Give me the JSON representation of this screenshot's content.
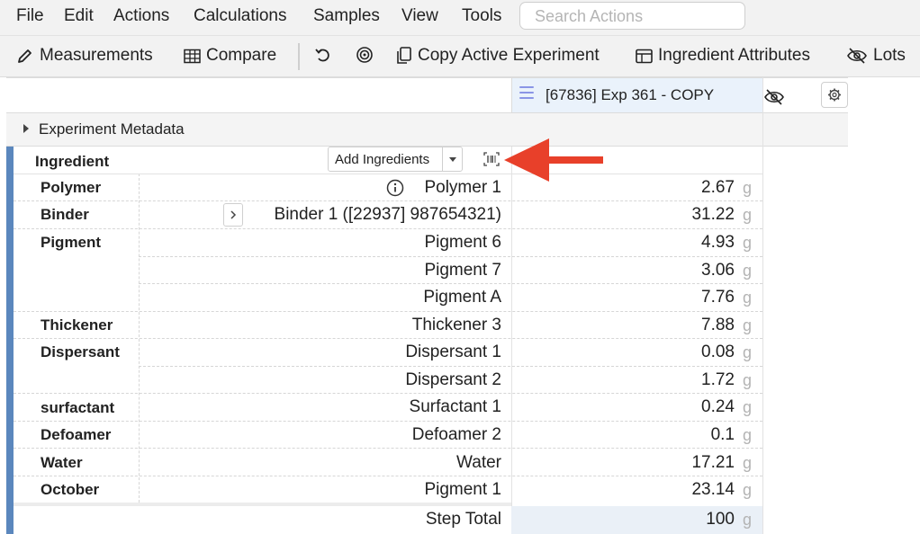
{
  "menu": {
    "items": [
      "File",
      "Edit",
      "Actions",
      "Calculations",
      "Samples",
      "View",
      "Tools"
    ],
    "search_placeholder": "Search Actions"
  },
  "toolbar": {
    "measurements": "Measurements",
    "compare": "Compare",
    "copy_experiment": "Copy Active Experiment",
    "ingredient_attributes": "Ingredient Attributes",
    "lots": "Lots"
  },
  "grid": {
    "column_header": "[67836] Exp 361 - COPY",
    "metadata_label": "Experiment Metadata",
    "ingredient_header": "Ingredient",
    "add_ingredients": "Add Ingredients",
    "rows": [
      {
        "category": "Polymer",
        "name": "Polymer 1",
        "qty": "2.67",
        "unit": "g"
      },
      {
        "category": "Binder",
        "name": "Binder 1 ([22937] 987654321)",
        "qty": "31.22",
        "unit": "g"
      },
      {
        "category": "Pigment",
        "name": "Pigment 6",
        "qty": "4.93",
        "unit": "g"
      },
      {
        "category": "",
        "name": "Pigment 7",
        "qty": "3.06",
        "unit": "g"
      },
      {
        "category": "",
        "name": "Pigment A",
        "qty": "7.76",
        "unit": "g"
      },
      {
        "category": "Thickener",
        "name": "Thickener 3",
        "qty": "7.88",
        "unit": "g"
      },
      {
        "category": "Dispersant",
        "name": "Dispersant 1",
        "qty": "0.08",
        "unit": "g"
      },
      {
        "category": "",
        "name": "Dispersant 2",
        "qty": "1.72",
        "unit": "g"
      },
      {
        "category": "surfactant",
        "name": "Surfactant 1",
        "qty": "0.24",
        "unit": "g"
      },
      {
        "category": "Defoamer",
        "name": "Defoamer 2",
        "qty": "0.1",
        "unit": "g"
      },
      {
        "category": "Water",
        "name": "Water",
        "qty": "17.21",
        "unit": "g"
      },
      {
        "category": "October",
        "name": "Pigment 1",
        "qty": "23.14",
        "unit": "g"
      }
    ],
    "total_label": "Step Total",
    "total_qty": "100",
    "total_unit": "g"
  },
  "colors": {
    "accent_bar": "#5b87bd",
    "annotation_arrow": "#e8402a",
    "header_bg": "#eaf2fb"
  }
}
